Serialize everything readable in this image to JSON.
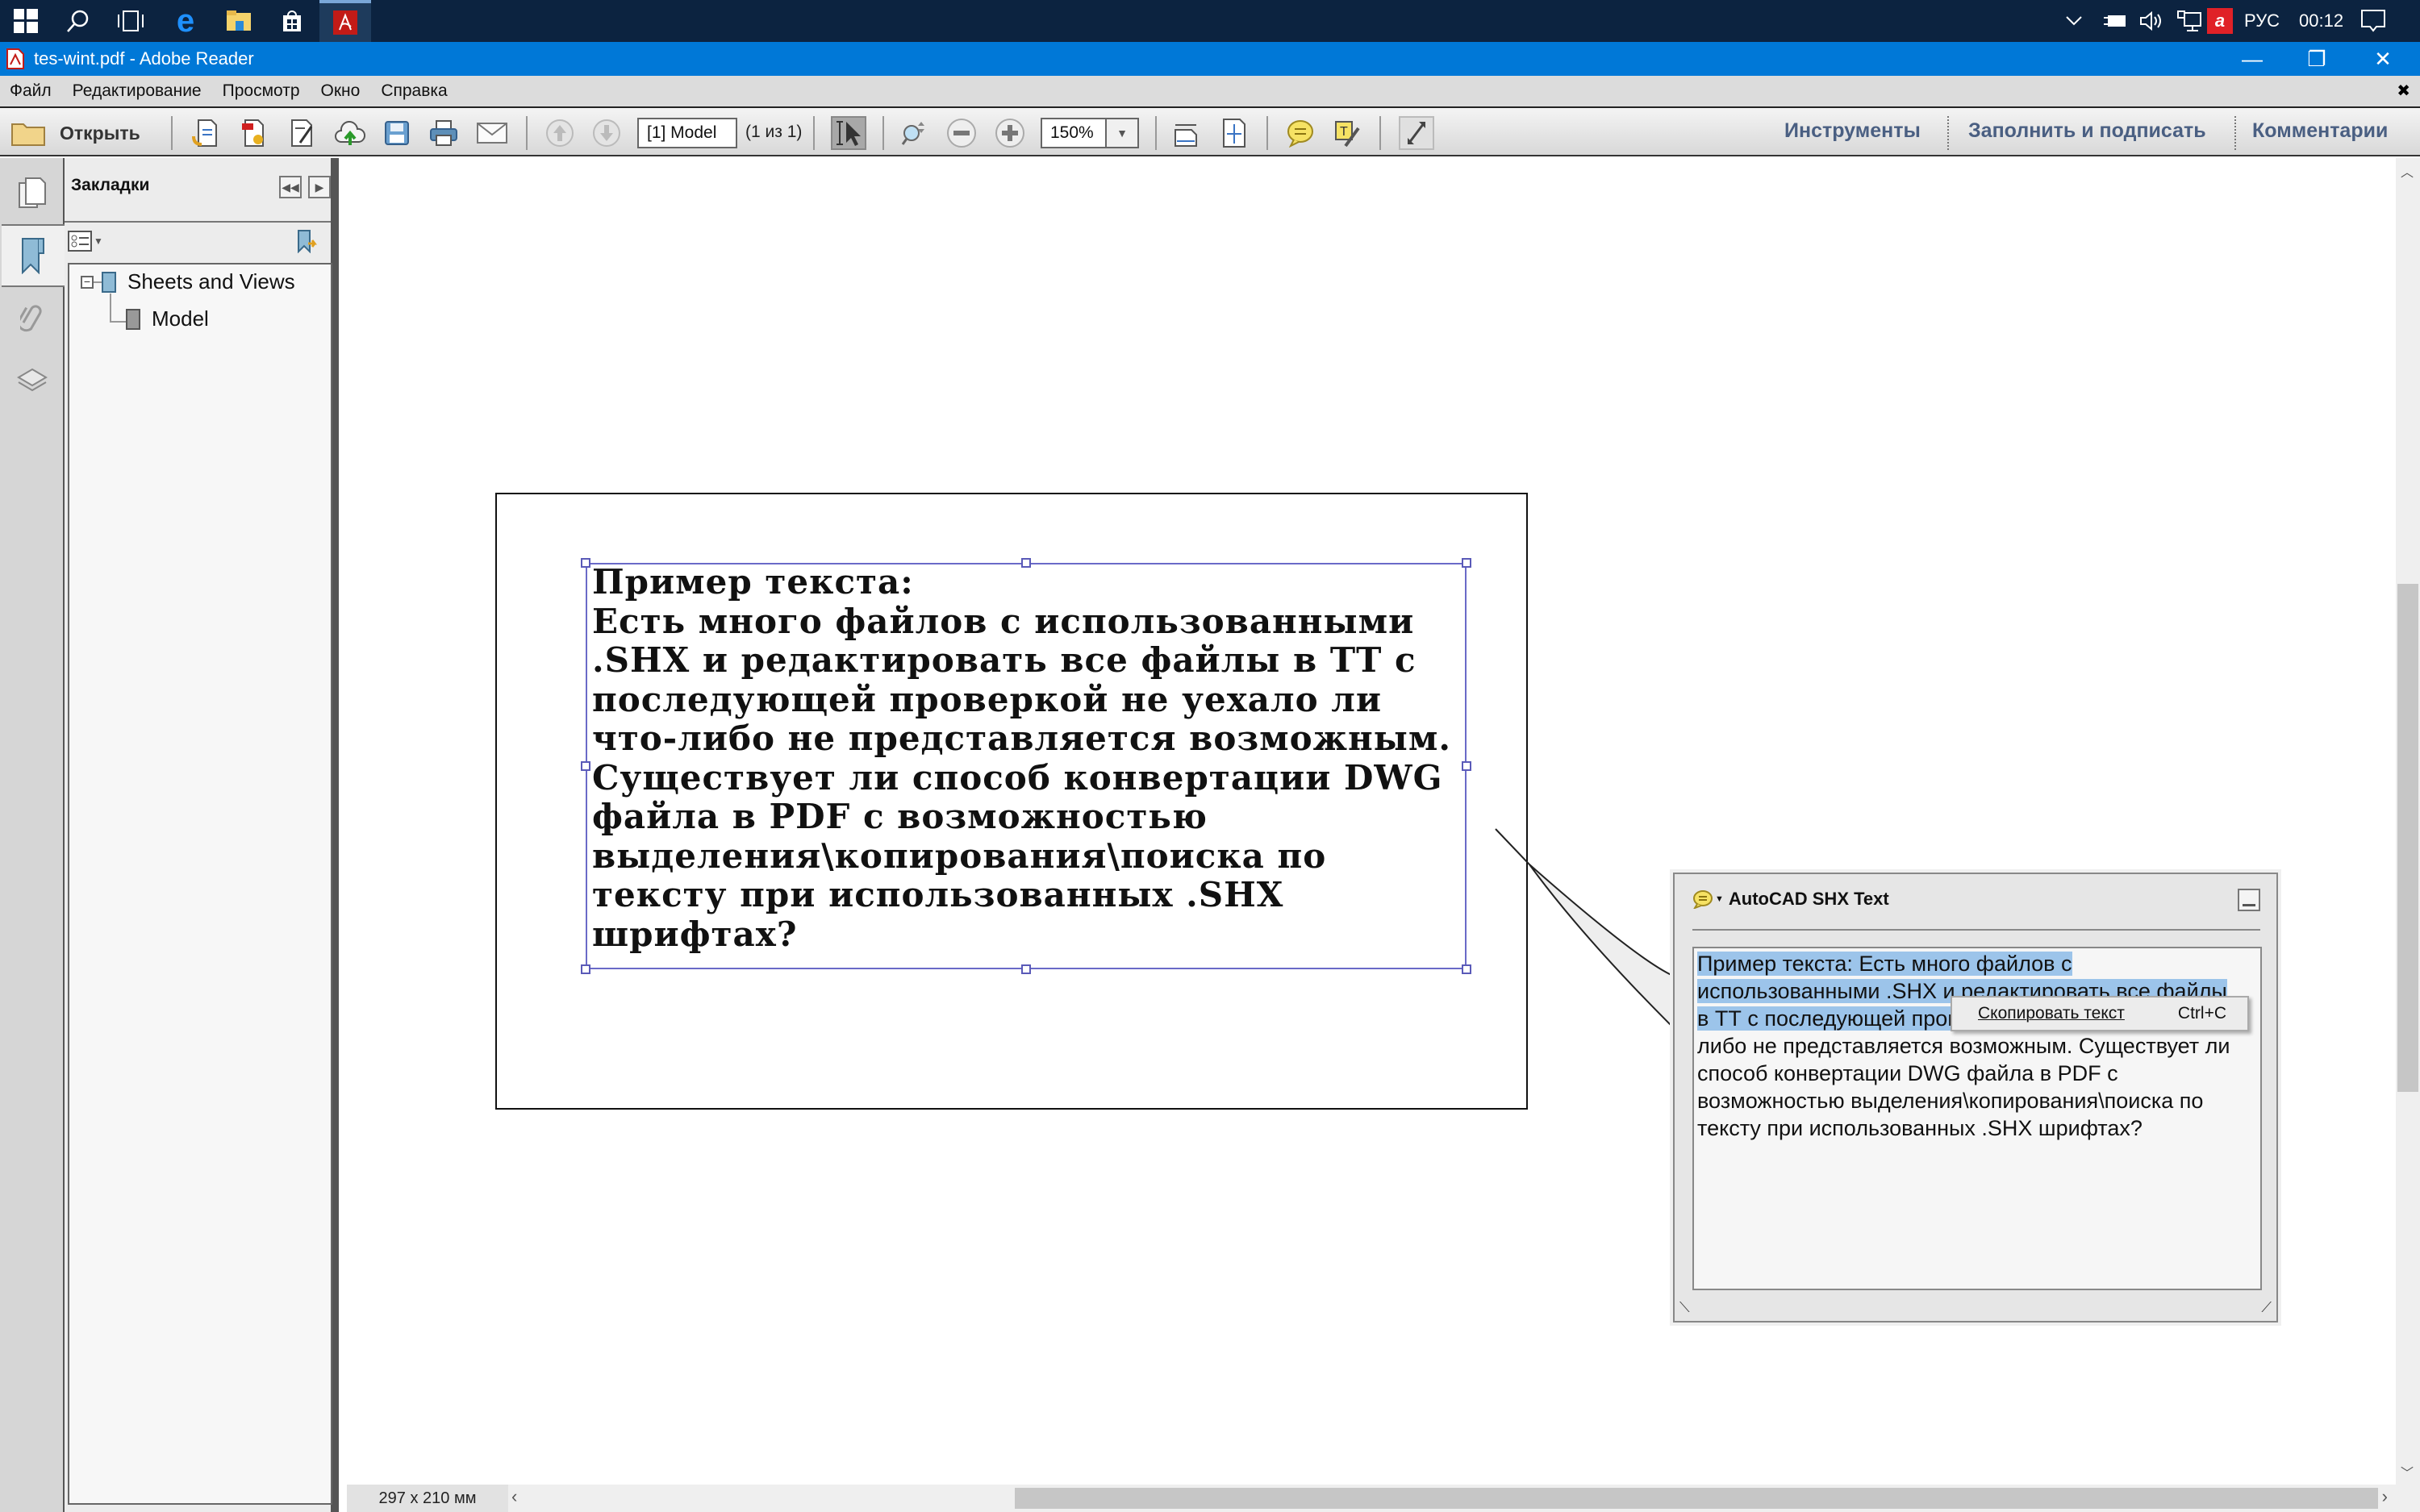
{
  "taskbar": {
    "icons": [
      "windows-start-icon",
      "search-icon",
      "task-view-icon",
      "edge-icon",
      "file-explorer-icon",
      "store-icon",
      "adobe-reader-icon"
    ],
    "tray": {
      "language": "РУС",
      "time": "00:12"
    }
  },
  "window": {
    "title": "tes-wint.pdf - Adobe Reader",
    "minimize": "—",
    "restore": "❐",
    "close": "✕"
  },
  "menu": {
    "items": [
      "Файл",
      "Редактирование",
      "Просмотр",
      "Окно",
      "Справка"
    ],
    "close_doc": "✖"
  },
  "toolbar": {
    "open_label": "Открыть",
    "page_field": "[1] Model",
    "page_count": "(1 из 1)",
    "zoom_value": "150%",
    "links": [
      "Инструменты",
      "Заполнить и подписать",
      "Комментарии"
    ]
  },
  "bookmarks": {
    "title": "Закладки",
    "tree": [
      {
        "label": "Sheets and Views",
        "expanded": true,
        "expander": "−"
      },
      {
        "label": "Model"
      }
    ]
  },
  "document": {
    "shx_lines": [
      "Пример текста:",
      "Есть много файлов с использованными",
      ".SHX и редактировать все файлы в ТТ с",
      "последующей проверкой не уехало ли",
      "что-либо не представляется возможным.",
      "Существует ли способ конвертации DWG",
      "файла в PDF с возможностью",
      "выделения\\копирования\\поиска по",
      "тексту при использованных .SHX",
      "шрифтах?"
    ],
    "page_size": "297 x 210 мм"
  },
  "note": {
    "title": "AutoCAD SHX Text",
    "lines_selected": [
      "Пример текста: Есть много файлов с",
      "использованными .SHX и редактировать все файлы",
      "в ТТ с последующей проверкой не уехало ли что-"
    ],
    "lines_rest": [
      "либо не представляется возможным. Существует ли",
      "способ конвертации DWG файла в PDF с",
      "возможностью выделения\\копирования\\поиска по",
      "тексту при использованных .SHX шрифтах?"
    ]
  },
  "context_menu": {
    "item_label": "Скопировать текст",
    "shortcut": "Ctrl+C"
  }
}
